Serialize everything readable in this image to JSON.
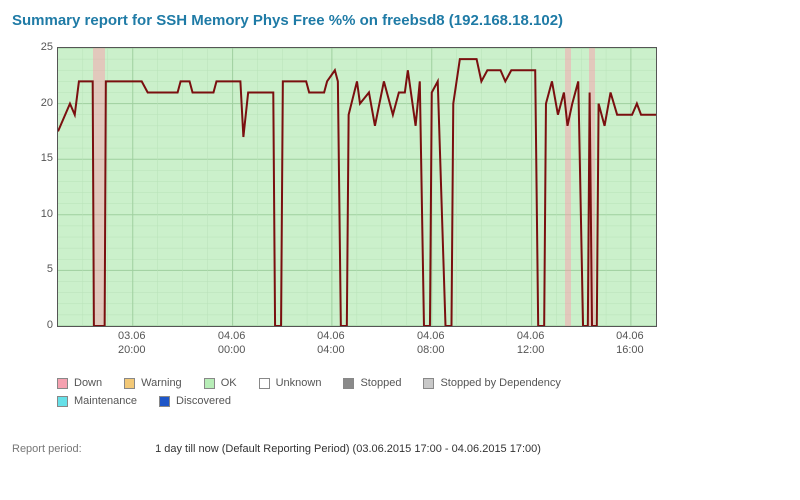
{
  "title": "Summary report for SSH Memory Phys Free %% on freebsd8 (192.168.18.102)",
  "footer": {
    "label": "Report period:",
    "value": "1 day till now (Default Reporting Period) (03.06.2015 17:00 - 04.06.2015 17:00)"
  },
  "legend": [
    {
      "label": "Down",
      "color": "#F5A1B0"
    },
    {
      "label": "Warning",
      "color": "#F2C877"
    },
    {
      "label": "OK",
      "color": "#B7EDB7"
    },
    {
      "label": "Unknown",
      "color": "#FFFFFF"
    },
    {
      "label": "Stopped",
      "color": "#8A8A8A"
    },
    {
      "label": "Stopped by Dependency",
      "color": "#C8C8C8"
    },
    {
      "label": "Maintenance",
      "color": "#66E0E8"
    },
    {
      "label": "Discovered",
      "color": "#1E56C8"
    }
  ],
  "chart_data": {
    "type": "line",
    "title": "SSH Memory Phys Free %%",
    "xlabel": "",
    "ylabel": "",
    "ylim": [
      0,
      25
    ],
    "y_ticks": [
      0,
      5,
      10,
      15,
      20,
      25
    ],
    "x_ticks": [
      {
        "pos": 0.125,
        "line1": "03.06",
        "line2": "20:00"
      },
      {
        "pos": 0.292,
        "line1": "04.06",
        "line2": "00:00"
      },
      {
        "pos": 0.458,
        "line1": "04.06",
        "line2": "04:00"
      },
      {
        "pos": 0.625,
        "line1": "04.06",
        "line2": "08:00"
      },
      {
        "pos": 0.792,
        "line1": "04.06",
        "line2": "12:00"
      },
      {
        "pos": 0.958,
        "line1": "04.06",
        "line2": "16:00"
      }
    ],
    "grid": {
      "major_x": true,
      "major_y": true,
      "minor": true
    },
    "down_bands": [
      {
        "start": 0.058,
        "end": 0.078
      },
      {
        "start": 0.848,
        "end": 0.858
      },
      {
        "start": 0.888,
        "end": 0.898
      }
    ],
    "series": [
      {
        "name": "Phys Free %",
        "color": "#7A0F0F",
        "data": [
          {
            "x": 0.0,
            "y": 17.5
          },
          {
            "x": 0.02,
            "y": 20.0
          },
          {
            "x": 0.028,
            "y": 19.0
          },
          {
            "x": 0.035,
            "y": 22.0
          },
          {
            "x": 0.058,
            "y": 22.0
          },
          {
            "x": 0.06,
            "y": 0.0
          },
          {
            "x": 0.078,
            "y": 0.0
          },
          {
            "x": 0.08,
            "y": 22.0
          },
          {
            "x": 0.14,
            "y": 22.0
          },
          {
            "x": 0.15,
            "y": 21.0
          },
          {
            "x": 0.2,
            "y": 21.0
          },
          {
            "x": 0.205,
            "y": 22.0
          },
          {
            "x": 0.22,
            "y": 22.0
          },
          {
            "x": 0.225,
            "y": 21.0
          },
          {
            "x": 0.26,
            "y": 21.0
          },
          {
            "x": 0.265,
            "y": 22.0
          },
          {
            "x": 0.305,
            "y": 22.0
          },
          {
            "x": 0.31,
            "y": 17.0
          },
          {
            "x": 0.318,
            "y": 21.0
          },
          {
            "x": 0.36,
            "y": 21.0
          },
          {
            "x": 0.363,
            "y": 0.0
          },
          {
            "x": 0.373,
            "y": 0.0
          },
          {
            "x": 0.376,
            "y": 22.0
          },
          {
            "x": 0.415,
            "y": 22.0
          },
          {
            "x": 0.42,
            "y": 21.0
          },
          {
            "x": 0.445,
            "y": 21.0
          },
          {
            "x": 0.45,
            "y": 22.0
          },
          {
            "x": 0.463,
            "y": 23.0
          },
          {
            "x": 0.468,
            "y": 22.0
          },
          {
            "x": 0.473,
            "y": 0.0
          },
          {
            "x": 0.483,
            "y": 0.0
          },
          {
            "x": 0.486,
            "y": 19.0
          },
          {
            "x": 0.5,
            "y": 22.0
          },
          {
            "x": 0.505,
            "y": 20.0
          },
          {
            "x": 0.52,
            "y": 21.0
          },
          {
            "x": 0.53,
            "y": 18.0
          },
          {
            "x": 0.545,
            "y": 22.0
          },
          {
            "x": 0.56,
            "y": 19.0
          },
          {
            "x": 0.57,
            "y": 21.0
          },
          {
            "x": 0.58,
            "y": 21.0
          },
          {
            "x": 0.585,
            "y": 23.0
          },
          {
            "x": 0.598,
            "y": 18.0
          },
          {
            "x": 0.605,
            "y": 22.0
          },
          {
            "x": 0.612,
            "y": 0.0
          },
          {
            "x": 0.622,
            "y": 0.0
          },
          {
            "x": 0.625,
            "y": 21.0
          },
          {
            "x": 0.635,
            "y": 22.0
          },
          {
            "x": 0.648,
            "y": 0.0
          },
          {
            "x": 0.658,
            "y": 0.0
          },
          {
            "x": 0.661,
            "y": 20.0
          },
          {
            "x": 0.672,
            "y": 24.0
          },
          {
            "x": 0.7,
            "y": 24.0
          },
          {
            "x": 0.708,
            "y": 22.0
          },
          {
            "x": 0.718,
            "y": 23.0
          },
          {
            "x": 0.74,
            "y": 23.0
          },
          {
            "x": 0.748,
            "y": 22.0
          },
          {
            "x": 0.758,
            "y": 23.0
          },
          {
            "x": 0.798,
            "y": 23.0
          },
          {
            "x": 0.803,
            "y": 0.0
          },
          {
            "x": 0.813,
            "y": 0.0
          },
          {
            "x": 0.816,
            "y": 20.0
          },
          {
            "x": 0.826,
            "y": 22.0
          },
          {
            "x": 0.836,
            "y": 19.0
          },
          {
            "x": 0.846,
            "y": 21.0
          },
          {
            "x": 0.852,
            "y": 18.0
          },
          {
            "x": 0.86,
            "y": 20.0
          },
          {
            "x": 0.87,
            "y": 22.0
          },
          {
            "x": 0.878,
            "y": 0.0
          },
          {
            "x": 0.886,
            "y": 0.0
          },
          {
            "x": 0.889,
            "y": 21.0
          },
          {
            "x": 0.893,
            "y": 0.0
          },
          {
            "x": 0.901,
            "y": 0.0
          },
          {
            "x": 0.904,
            "y": 20.0
          },
          {
            "x": 0.914,
            "y": 18.0
          },
          {
            "x": 0.924,
            "y": 21.0
          },
          {
            "x": 0.935,
            "y": 19.0
          },
          {
            "x": 0.96,
            "y": 19.0
          },
          {
            "x": 0.968,
            "y": 20.0
          },
          {
            "x": 0.975,
            "y": 19.0
          },
          {
            "x": 1.0,
            "y": 19.0
          }
        ]
      }
    ]
  }
}
